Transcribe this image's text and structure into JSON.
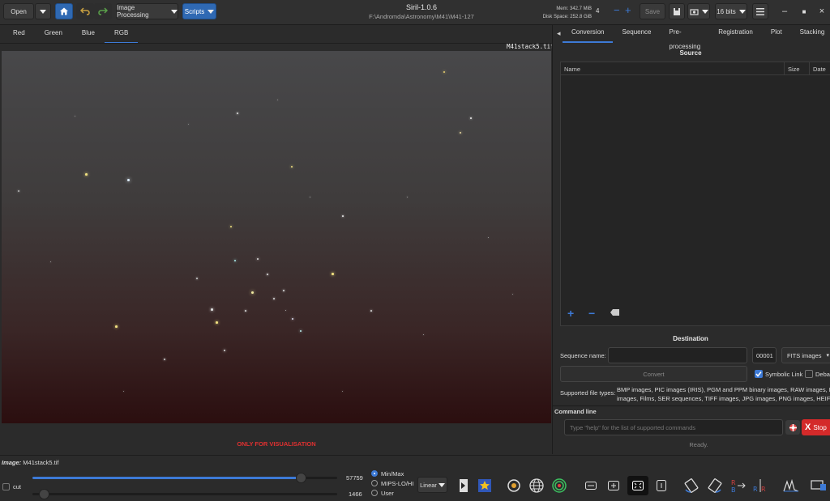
{
  "toolbar": {
    "open_label": "Open",
    "image_processing_label": "Image Processing",
    "scripts_label": "Scripts",
    "save_label": "Save",
    "bits_label": "16 bits",
    "threads_value": "4"
  },
  "window": {
    "title": "Siril-1.0.6",
    "path": "F:\\Andromda\\Astronomy\\M41\\M41-127"
  },
  "status": {
    "mem": "Mem: 342.7 MiB",
    "disk": "Disk Space: 252.8 GiB"
  },
  "channel_tabs": [
    "Red",
    "Green",
    "Blue",
    "RGB"
  ],
  "image": {
    "filename_overlay": "M41stack5.tif",
    "warning": "ONLY FOR VISUALISATION",
    "image_label": "Image:",
    "image_name": "M41stack5.tif"
  },
  "right_tabs": [
    "Conversion",
    "Sequence",
    "Pre-processing",
    "Registration",
    "Plot",
    "Stacking"
  ],
  "source": {
    "heading": "Source",
    "columns": [
      "Name",
      "Size",
      "Date"
    ]
  },
  "destination": {
    "heading": "Destination",
    "sequence_name_label": "Sequence name:",
    "index_value": "00001",
    "format_value": "FITS images",
    "convert_label": "Convert",
    "symbolic_link_label": "Symbolic Link",
    "debayer_label": "Deba",
    "supported_label": "Supported file types:",
    "supported_text_1": "BMP images, PIC images (IRIS), PGM and PPM binary images, RAW images, FITS-C",
    "supported_text_2": "images, Films, SER sequences, TIFF images, JPG images, PNG images, HEIF images"
  },
  "command": {
    "heading": "Command line",
    "placeholder": "Type \"help\" for the list of supported commands",
    "stop_label": "Stop",
    "status": "Ready."
  },
  "bottom": {
    "cut_label": "cut",
    "high_value": "57759",
    "low_value": "1466",
    "high_fraction": 0.88,
    "low_fraction": 0.02,
    "modes": [
      "Min/Max",
      "MIPS-LO/HI",
      "User"
    ],
    "stretch_value": "Linear"
  },
  "colors": {
    "accent": "#3d7ad6",
    "warning": "#e03030",
    "stop": "#d42a2a"
  }
}
